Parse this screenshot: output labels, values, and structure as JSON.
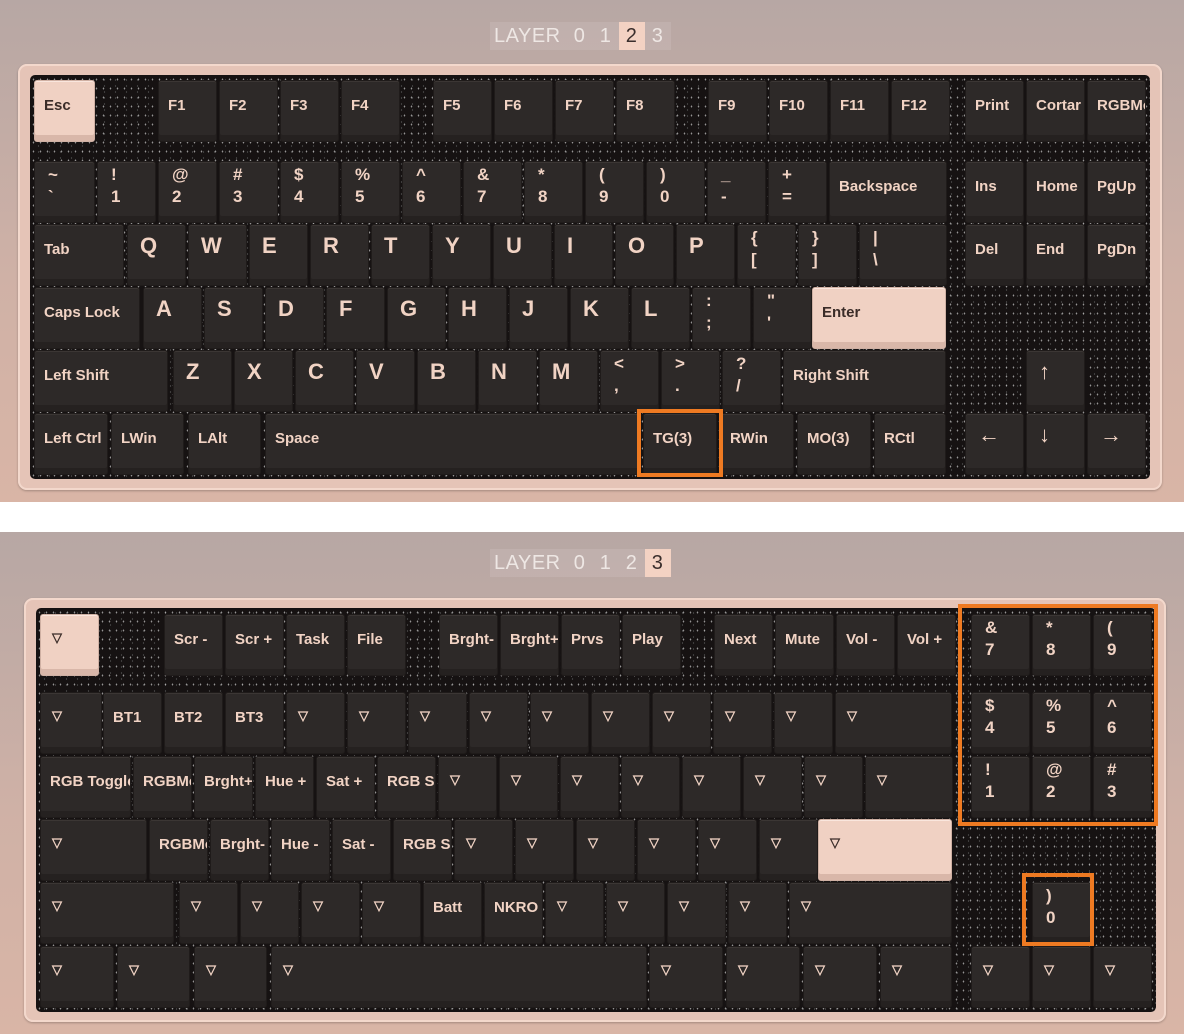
{
  "panels": [
    {
      "layer_label": "LAYER",
      "layers": [
        "0",
        "1",
        "2",
        "3"
      ],
      "active_layer": "2",
      "highlighted_keys": [
        "TG(3)"
      ],
      "keys": [
        [
          "Esc",
          "F1",
          "F2",
          "F3",
          "F4",
          "F5",
          "F6",
          "F7",
          "F8",
          "F9",
          "F10",
          "F11",
          "F12",
          "Print",
          "Cortar",
          "RGBMc"
        ],
        [
          [
            "~",
            "`"
          ],
          [
            "!",
            "1"
          ],
          [
            "@",
            "2"
          ],
          [
            "#",
            "3"
          ],
          [
            "$",
            "4"
          ],
          [
            "%",
            "5"
          ],
          [
            "^",
            "6"
          ],
          [
            "&",
            "7"
          ],
          [
            "*",
            "8"
          ],
          [
            "(",
            "9"
          ],
          [
            ")",
            "0"
          ],
          [
            "_",
            "-"
          ],
          [
            "+",
            "="
          ],
          "Backspace",
          "Ins",
          "Home",
          "PgUp"
        ],
        [
          "Tab",
          "Q",
          "W",
          "E",
          "R",
          "T",
          "Y",
          "U",
          "I",
          "O",
          "P",
          [
            "{",
            "["
          ],
          [
            "}",
            "]"
          ],
          [
            "|",
            "\\"
          ],
          "Del",
          "End",
          "PgDn"
        ],
        [
          "Caps Lock",
          "A",
          "S",
          "D",
          "F",
          "G",
          "H",
          "J",
          "K",
          "L",
          [
            ":",
            ";"
          ],
          [
            "\"",
            "'"
          ],
          "Enter"
        ],
        [
          "Left Shift",
          "Z",
          "X",
          "C",
          "V",
          "B",
          "N",
          "M",
          [
            "<",
            ","
          ],
          [
            ">",
            "."
          ],
          [
            "?",
            "/"
          ],
          "Right Shift",
          "↑"
        ],
        [
          "Left Ctrl",
          "LWin",
          "LAlt",
          "Space",
          "TG(3)",
          "RWin",
          "MO(3)",
          "RCtl",
          "←",
          "↓",
          "→"
        ]
      ]
    },
    {
      "layer_label": "LAYER",
      "layers": [
        "0",
        "1",
        "2",
        "3"
      ],
      "active_layer": "3",
      "highlighted_keys": [
        "numpad-7-8-9-4-5-6-1-2-3",
        "numpad-0"
      ],
      "keys": [
        [
          "▽",
          "Scr -",
          "Scr +",
          "Task",
          "File",
          "Brght-",
          "Brght+",
          "Prvs",
          "Play",
          "Next",
          "Mute",
          "Vol -",
          "Vol +",
          [
            "&",
            "7"
          ],
          [
            "*",
            "8"
          ],
          [
            "(",
            "9"
          ]
        ],
        [
          "▽",
          "BT1",
          "BT2",
          "BT3",
          "▽",
          "▽",
          "▽",
          "▽",
          "▽",
          "▽",
          "▽",
          "▽",
          "▽",
          "▽",
          [
            "$",
            "4"
          ],
          [
            "%",
            "5"
          ],
          [
            "^",
            "6"
          ]
        ],
        [
          "RGB Toggle",
          "RGBMc",
          "Brght+",
          "Hue +",
          "Sat +",
          "RGB SI",
          "▽",
          "▽",
          "▽",
          "▽",
          "▽",
          "▽",
          "▽",
          "▽",
          [
            "!",
            "1"
          ],
          [
            "@",
            "2"
          ],
          [
            "#",
            "3"
          ]
        ],
        [
          "▽",
          "RGBMc",
          "Brght-",
          "Hue -",
          "Sat -",
          "RGB SI",
          "▽",
          "▽",
          "▽",
          "▽",
          "▽",
          "▽",
          "▽"
        ],
        [
          "▽",
          "▽",
          "▽",
          "▽",
          "▽",
          "Batt",
          "NKRO",
          "▽",
          "▽",
          "▽",
          "▽",
          "▽",
          [
            ")",
            "0"
          ]
        ],
        [
          "▽",
          "▽",
          "▽",
          "▽",
          "▽",
          "▽",
          "▽",
          "▽",
          "▽",
          "▽",
          "▽"
        ]
      ]
    }
  ]
}
